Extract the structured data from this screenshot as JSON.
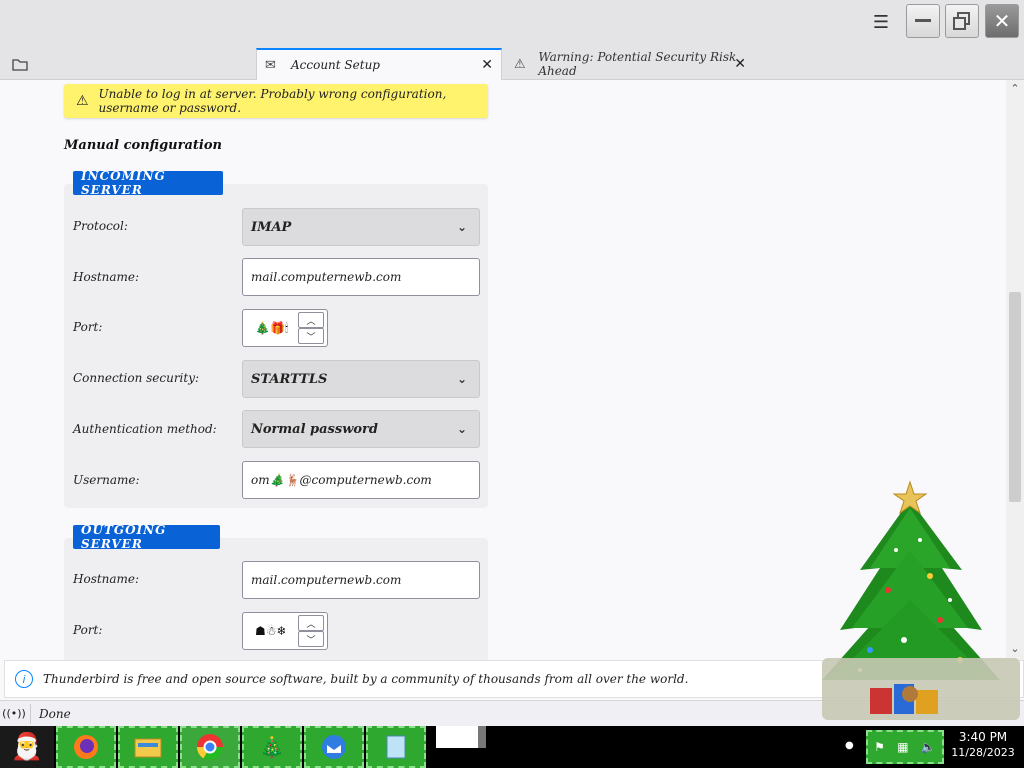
{
  "window": {
    "menu_icon": "hamburger-icon",
    "minimize_icon": "minimize-icon",
    "maximize_icon": "restore-icon",
    "close_icon": "close-icon"
  },
  "tabs": [
    {
      "label": "",
      "icon": "folder-icon"
    },
    {
      "label": "Account Setup",
      "icon": "mail-icon",
      "active": true
    },
    {
      "label": "Warning: Potential Security Risk Ahead",
      "icon": "warning-icon"
    }
  ],
  "error_banner": {
    "text": "Unable to log in at server. Probably wrong configuration, username or password."
  },
  "manual": {
    "title": "Manual configuration"
  },
  "incoming": {
    "section_label": "INCOMING SERVER",
    "protocol_label": "Protocol:",
    "protocol_value": "IMAP",
    "hostname_label": "Hostname:",
    "hostname_value": "mail.computernewb.com",
    "port_label": "Port:",
    "port_value": "🎄🎁🕯",
    "security_label": "Connection security:",
    "security_value": "STARTTLS",
    "auth_label": "Authentication method:",
    "auth_value": "Normal password",
    "username_label": "Username:",
    "username_value": "om🎄🦌@computernewb.com"
  },
  "outgoing": {
    "section_label": "OUTGOING SERVER",
    "hostname_label": "Hostname:",
    "hostname_value": "mail.computernewb.com",
    "port_label": "Port:",
    "port_value": "☗☃❄"
  },
  "notification": {
    "text": "Thunderbird is free and open source software, built by a community of thousands from all over the world."
  },
  "status": {
    "text": "Done"
  },
  "taskbar": {
    "time": "3:40 PM",
    "date": "11/28/2023"
  },
  "colors": {
    "accent": "#0a63d6",
    "banner": "#fff36e",
    "taskbar_item": "#2ea82e"
  }
}
